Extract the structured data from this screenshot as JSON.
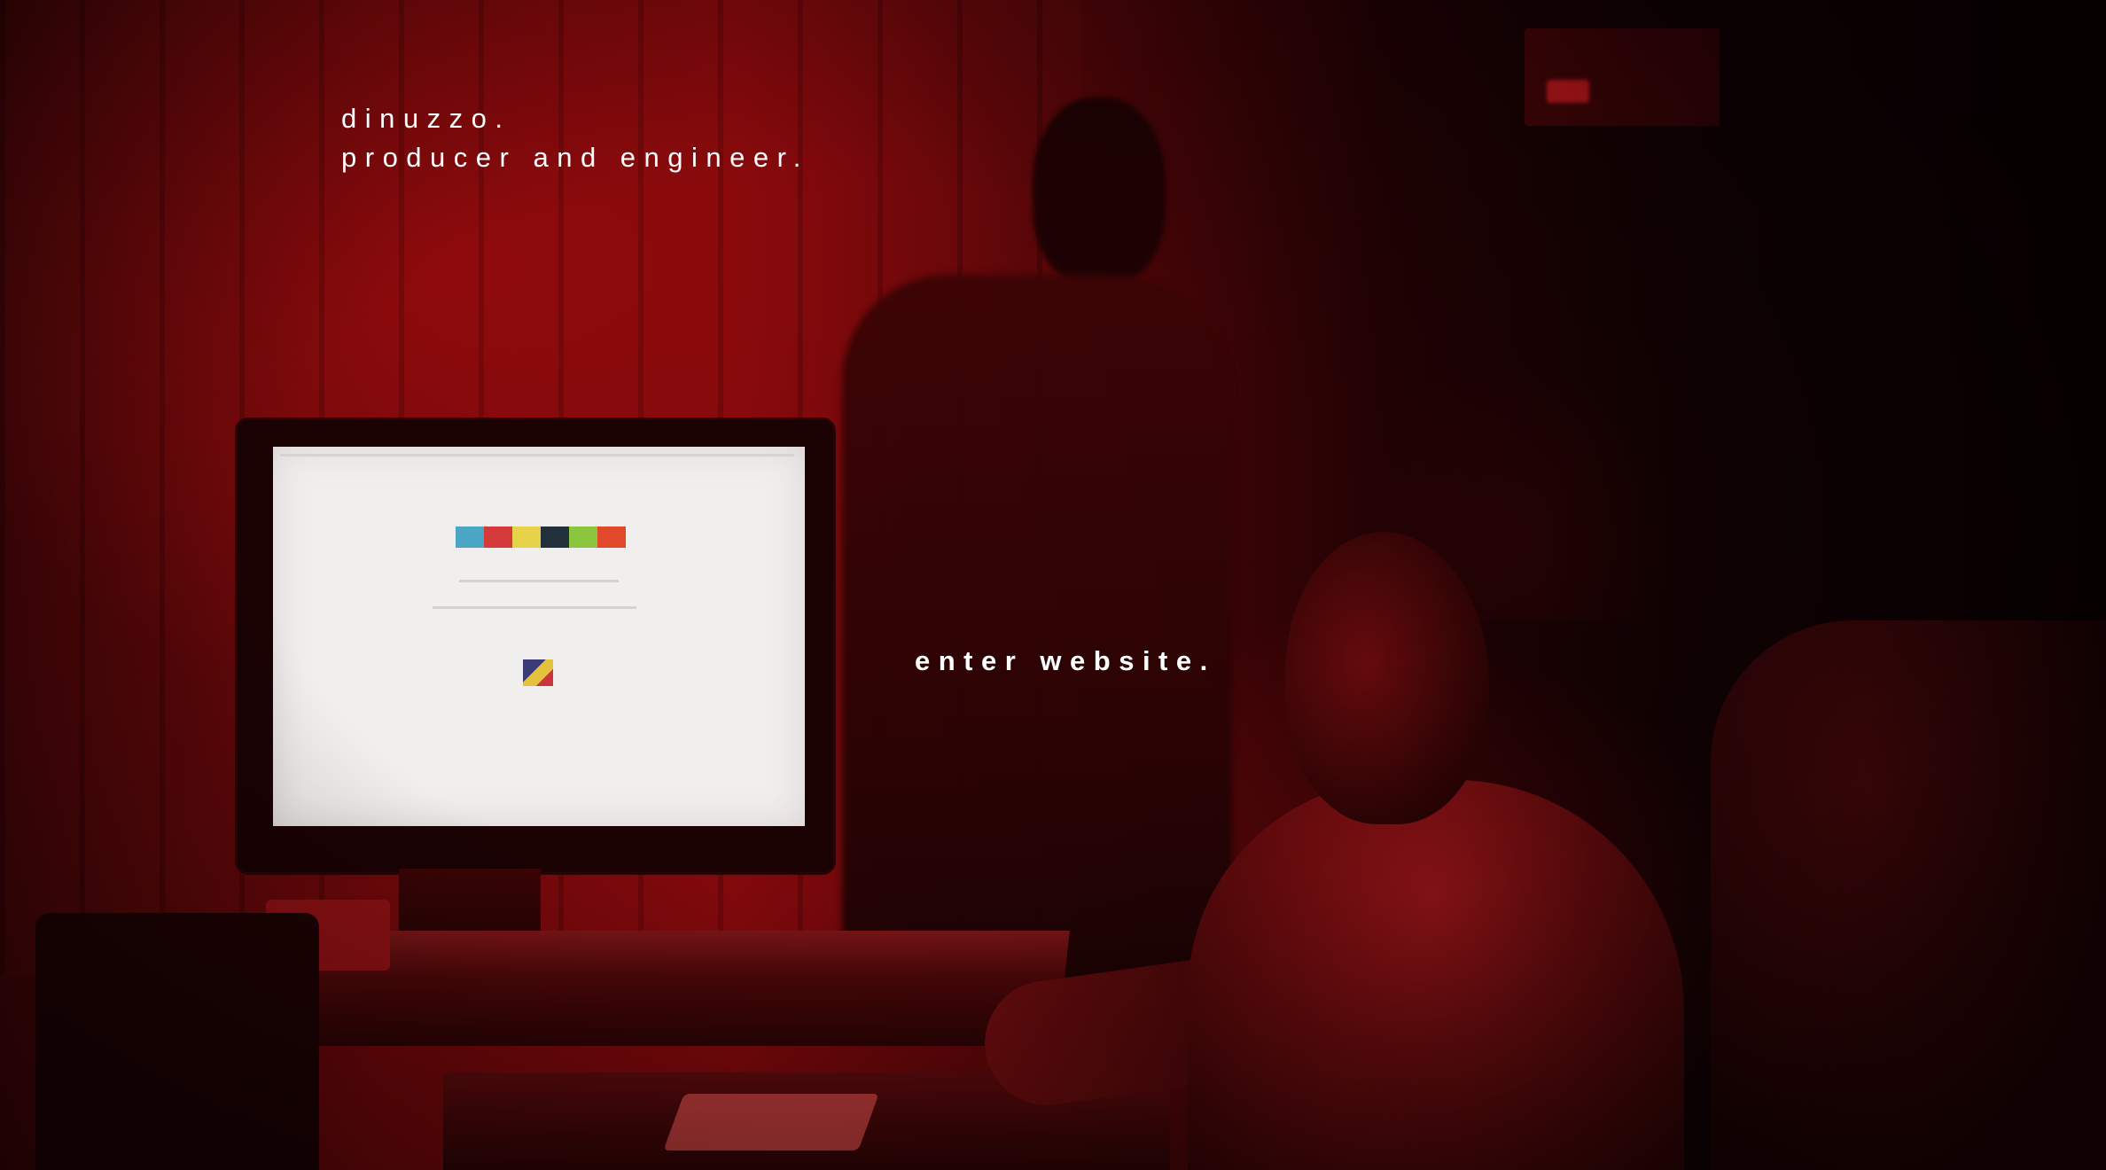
{
  "brand": {
    "name": "dinuzzo.",
    "tagline": "producer and engineer."
  },
  "cta": {
    "label": "enter website."
  },
  "colors": {
    "text": "#ffffff",
    "background_tint": "#7d080b",
    "background_dark": "#120203"
  },
  "background": {
    "icon": "studio-photo-background"
  }
}
